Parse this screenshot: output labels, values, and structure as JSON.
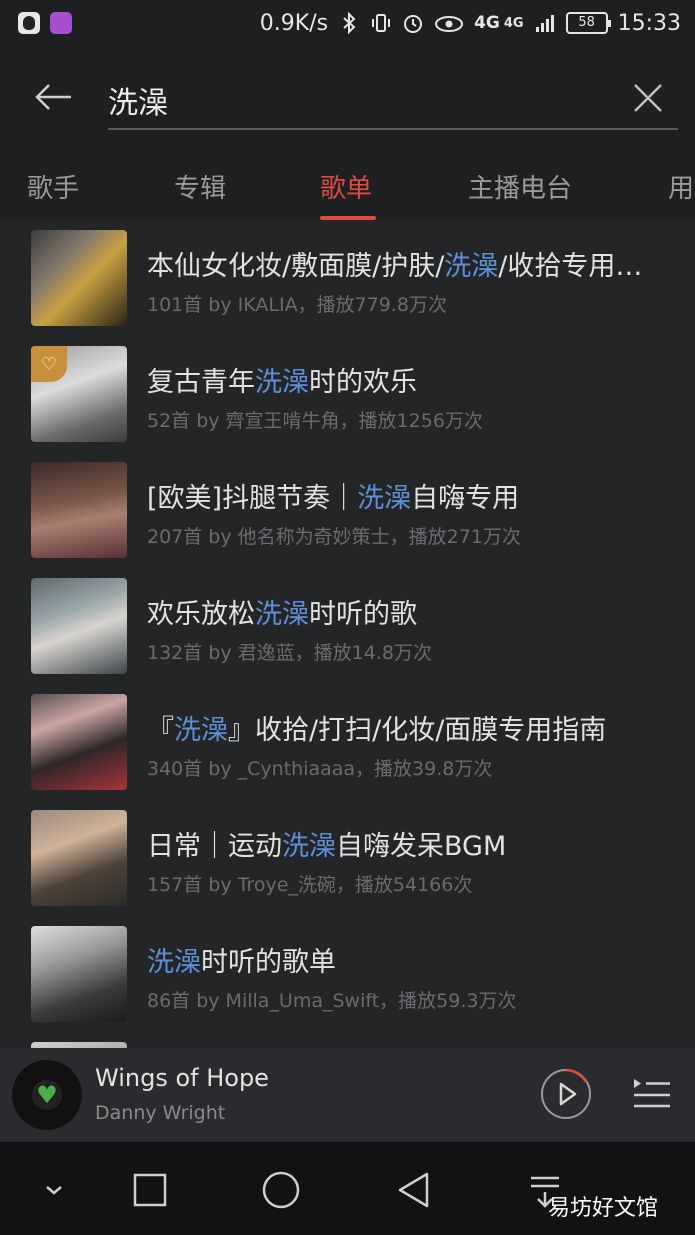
{
  "status_bar": {
    "net_speed": "0.9K/s",
    "network_4g_a": "4G",
    "network_4g_b": "4G",
    "battery": "58",
    "time": "15:33",
    "icons": [
      "qq-icon",
      "gallery-icon",
      "bluetooth-icon",
      "vibrate-icon",
      "alarm-icon",
      "eye-icon",
      "signal-icon"
    ]
  },
  "search": {
    "query": "洗澡"
  },
  "tabs": [
    {
      "label": "歌手"
    },
    {
      "label": "专辑"
    },
    {
      "label": "歌单",
      "active": true
    },
    {
      "label": "主播电台"
    },
    {
      "label": "用"
    }
  ],
  "highlight_color": "#5c8fd6",
  "accent_color": "#e04a3f",
  "playlists": [
    {
      "title_pre": "本仙女化妆/敷面膜/护肤/",
      "title_hl": "洗澡",
      "title_post": "/收拾专用…",
      "meta": "101首  by IKALIA，播放779.8万次"
    },
    {
      "title_pre": "复古青年",
      "title_hl": "洗澡",
      "title_post": "时的欢乐",
      "meta": "52首  by 齊宣王啃牛角，播放1256万次"
    },
    {
      "title_pre": "[欧美]抖腿节奏｜",
      "title_hl": "洗澡",
      "title_post": "自嗨专用",
      "meta": "207首  by 他名称为奇妙策士，播放271万次"
    },
    {
      "title_pre": "欢乐放松",
      "title_hl": "洗澡",
      "title_post": "时听的歌",
      "meta": "132首  by 君逸蓝，播放14.8万次"
    },
    {
      "title_pre": "『",
      "title_hl": "洗澡",
      "title_post": "』收拾/打扫/化妆/面膜专用指南",
      "meta": "340首  by _Cynthiaaaa，播放39.8万次"
    },
    {
      "title_pre": "日常｜运动",
      "title_hl": "洗澡",
      "title_post": "自嗨发呆BGM",
      "meta": "157首  by Troye_洗碗，播放54166次"
    },
    {
      "title_pre": "",
      "title_hl": "洗澡",
      "title_post": "时听的歌单",
      "meta": "86首  by Milla_Uma_Swift，播放59.3万次"
    }
  ],
  "player": {
    "song": "Wings of Hope",
    "artist": "Danny Wright"
  },
  "watermark": "易坊好文馆"
}
